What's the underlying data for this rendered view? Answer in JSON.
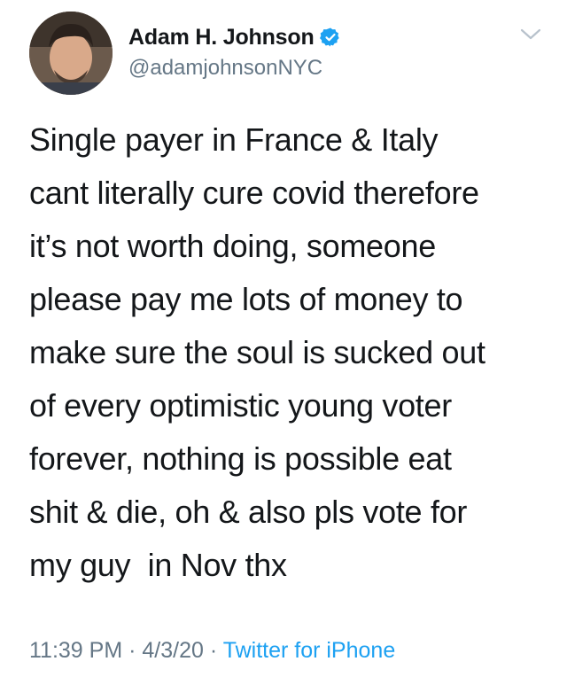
{
  "author": {
    "display_name": "Adam H. Johnson",
    "handle": "@adamjohnsonNYC",
    "verified": true
  },
  "tweet": {
    "text": "Single payer in France & Italy\ncant literally cure covid therefore\nit’s not worth doing, someone\nplease pay me lots of money to\nmake sure the soul is sucked out\nof every optimistic young voter\nforever, nothing is possible eat\nshit & die, oh & also pls vote for\nmy guy  in Nov thx",
    "time": "11:39 PM",
    "separator": "·",
    "date": "4/3/20",
    "source": "Twitter for iPhone"
  },
  "icons": {
    "verified": "verified-badge-icon",
    "menu": "chevron-down-icon"
  },
  "colors": {
    "text": "#14171a",
    "secondary": "#657786",
    "accent": "#1da1f2"
  }
}
